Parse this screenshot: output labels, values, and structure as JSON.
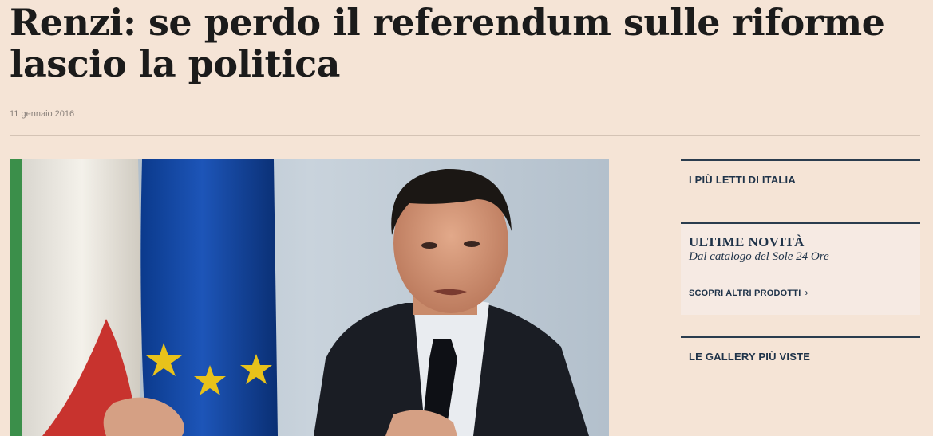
{
  "article": {
    "title": "Renzi: se perdo il referendum sulle riforme lascio la politica",
    "date": "11 gennaio 2016"
  },
  "sidebar": {
    "most_read": "I PIÙ LETTI DI ITALIA",
    "novita_title": "ULTIME NOVITÀ",
    "novita_subtitle": "Dal catalogo del Sole 24 Ore",
    "novita_link": "SCOPRI ALTRI PRODOTTI",
    "gallery": "LE GALLERY PIÙ VISTE"
  },
  "icons": {
    "link_chevron": "chevron-right-icon"
  },
  "colors": {
    "background": "#f5e4d6",
    "accent": "#1f3349"
  }
}
